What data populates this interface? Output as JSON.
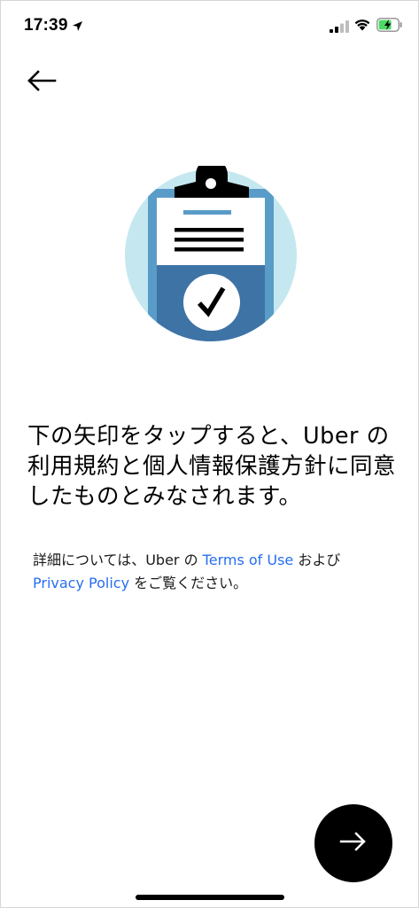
{
  "status_bar": {
    "time": "17:39",
    "icons": [
      "location-arrow-icon",
      "cellular-signal-icon",
      "wifi-icon",
      "battery-charging-icon"
    ]
  },
  "nav": {
    "back_icon": "arrow-left-icon"
  },
  "illustration": {
    "icon": "clipboard-checkmark-icon"
  },
  "main": {
    "line1": "下の矢印をタップすると、Uber の",
    "line2": "利用規約と個人情報保護方針に同意",
    "line3": "したものとみなされます。"
  },
  "detail": {
    "prefix": "詳細については、Uber の ",
    "terms_link": "Terms of Use",
    "middle": " および",
    "privacy_link": "Privacy Policy",
    "suffix": " をご覧ください。"
  },
  "next_button": {
    "icon": "arrow-right-icon"
  },
  "colors": {
    "link": "#276ef1",
    "illustration_circle": "#c5e8f0",
    "clipboard_blue": "#3e73a6",
    "clipboard_light": "#5a9cc8",
    "battery_green": "#4cd964"
  }
}
